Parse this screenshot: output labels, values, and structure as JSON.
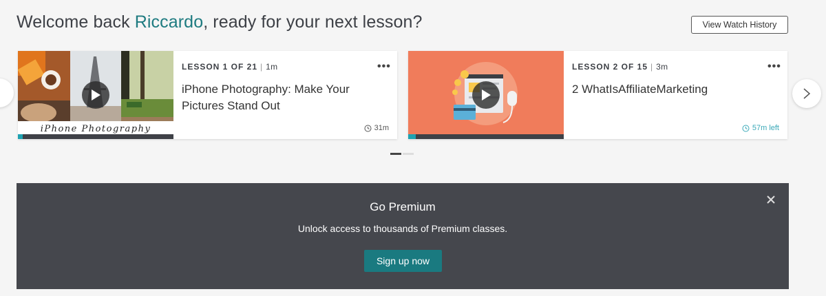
{
  "header": {
    "greeting_prefix": "Welcome back ",
    "user_name": "Riccardo",
    "greeting_suffix": ", ready for your next lesson?",
    "history_button": "View Watch History"
  },
  "lessons": [
    {
      "lesson_label": "LESSON 1 OF 21",
      "duration": "1m",
      "title": "iPhone Photography: Make Your Pictures Stand Out",
      "time_text": "31m",
      "thumb_caption": "iPhone Photography",
      "progress": 0.03
    },
    {
      "lesson_label": "LESSON 2 OF 15",
      "duration": "3m",
      "title": "2 WhatIsAffiliateMarketing",
      "time_text": "57m left",
      "progress": 0.05
    }
  ],
  "pagination": {
    "pages": 2,
    "active": 0
  },
  "premium": {
    "title": "Go Premium",
    "subtitle": "Unlock access to thousands of Premium classes.",
    "button": "Sign up now"
  },
  "colors": {
    "accent": "#1e7b80",
    "banner_bg": "#45474d",
    "progress": "#1ea2b1",
    "thumb2_bg": "#f07c5b"
  }
}
